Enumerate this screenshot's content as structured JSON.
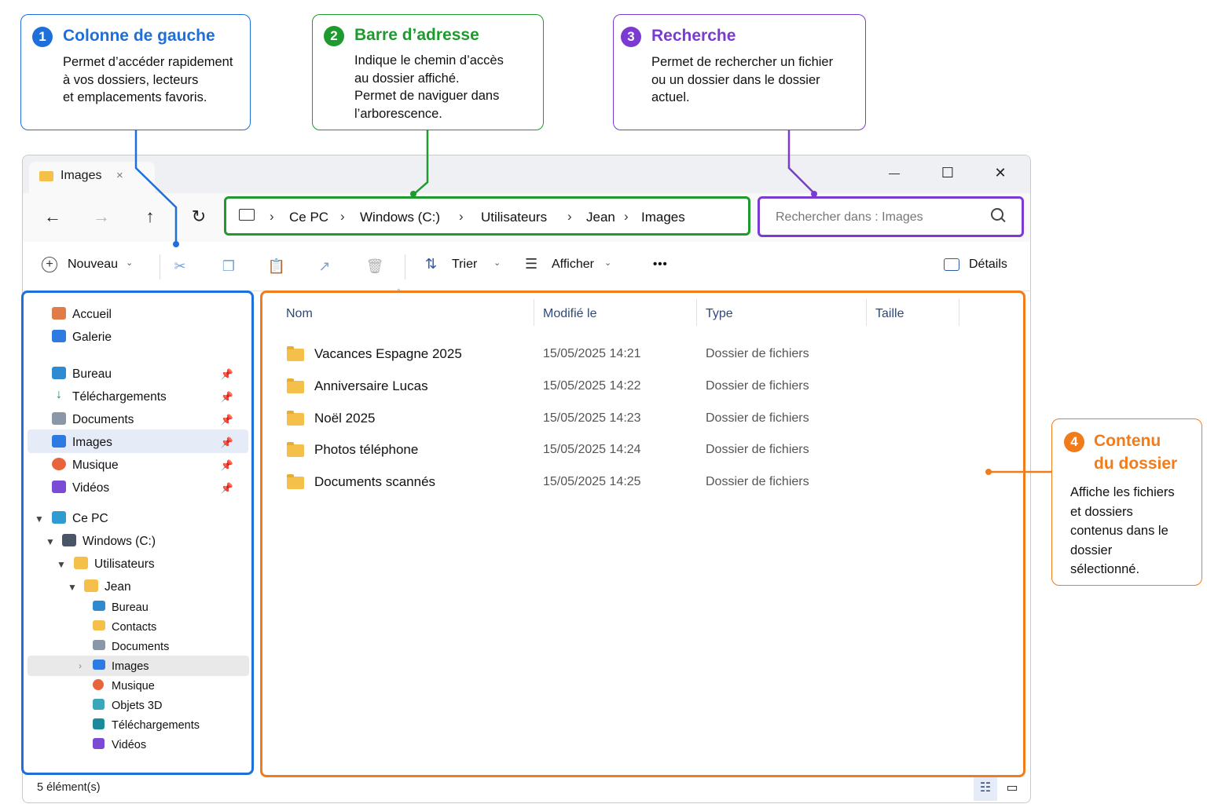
{
  "callouts": [
    {
      "number": "1",
      "title": "Colonne de gauche",
      "body": "Permet d’accéder rapidement\nà vos dossiers, lecteurs\net emplacements favoris.",
      "color": "#1e6fd9"
    },
    {
      "number": "2",
      "title": "Barre d’adresse",
      "body": "Indique le chemin d’accès\nau dossier affiché.\nPermet de naviguer dans\nl’arborescence.",
      "color": "#1e9a2e"
    },
    {
      "number": "3",
      "title": "Recherche",
      "body": "Permet de rechercher un fichier\nou un dossier dans le dossier\nactuel.",
      "color": "#7b3bd0"
    },
    {
      "number": "4",
      "title_line1": "Contenu",
      "title_line2": "du dossier",
      "body": "Affiche les fichiers\net dossiers\ncontenus dans le\n dossier\n sélectionné.",
      "color": "#f07c1c"
    }
  ],
  "window": {
    "tab_title": "Images",
    "tab_close": "×",
    "controls": {
      "minimize": "—",
      "maximize": "☐",
      "close": "✕"
    }
  },
  "address_bar": {
    "crumbs": [
      "Ce PC",
      "Windows (C:)",
      "Utilisateurs",
      "Jean",
      "Images"
    ],
    "separator": "›"
  },
  "search": {
    "placeholder": "Rechercher dans : Images"
  },
  "command_bar": {
    "new_label": "Nouveau",
    "sort_label": "Trier",
    "view_label": "Afficher",
    "more_label": "•••",
    "details_label": "Détails"
  },
  "sidebar": {
    "quick": [
      {
        "label": "Accueil",
        "icon": "home-icon"
      },
      {
        "label": "Galerie",
        "icon": "gallery-icon"
      }
    ],
    "pinned": [
      {
        "label": "Bureau",
        "icon": "desktop-icon"
      },
      {
        "label": "Téléchargements",
        "icon": "download-icon"
      },
      {
        "label": "Documents",
        "icon": "documents-icon"
      },
      {
        "label": "Images",
        "icon": "pictures-icon",
        "selected": true
      },
      {
        "label": "Musique",
        "icon": "music-icon"
      },
      {
        "label": "Vidéos",
        "icon": "videos-icon"
      }
    ],
    "tree": {
      "pc": "Ce PC",
      "drive": "Windows (C:)",
      "users": "Utilisateurs",
      "user": "Jean",
      "children": [
        "Bureau",
        "Contacts",
        "Documents",
        "Images",
        "Musique",
        "Objets 3D",
        "Téléchargements",
        "Vidéos"
      ]
    }
  },
  "table": {
    "headers": {
      "name": "Nom",
      "modified": "Modifié le",
      "type": "Type",
      "size": "Taille"
    },
    "rows": [
      {
        "name": "Vacances Espagne 2025",
        "modified": "15/05/2025 14:21",
        "type": "Dossier de fichiers"
      },
      {
        "name": "Anniversaire Lucas",
        "modified": "15/05/2025 14:22",
        "type": "Dossier de fichiers"
      },
      {
        "name": "Noël 2025",
        "modified": "15/05/2025 14:23",
        "type": "Dossier de fichiers"
      },
      {
        "name": "Photos téléphone",
        "modified": "15/05/2025 14:24",
        "type": "Dossier de fichiers"
      },
      {
        "name": "Documents scannés",
        "modified": "15/05/2025 14:25",
        "type": "Dossier de fichiers"
      }
    ]
  },
  "status_bar": {
    "item_count": "5 élément(s)"
  }
}
